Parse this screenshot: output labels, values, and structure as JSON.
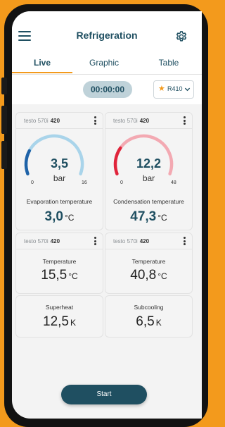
{
  "header": {
    "title": "Refrigeration"
  },
  "tabs": [
    {
      "label": "Live"
    },
    {
      "label": "Graphic"
    },
    {
      "label": "Table"
    }
  ],
  "timer": "00:00:00",
  "refrigerant": "R410",
  "cards": {
    "evap": {
      "device": "testo 570i",
      "device_id": "420",
      "value": "3,5",
      "unit": "bar",
      "min": "0",
      "max": "16",
      "level": 0.22,
      "accent": "#1f63a8",
      "track": "#a9d4ea",
      "label": "Evaporation temperature",
      "temp": "3,0",
      "temp_unit": "°C"
    },
    "cond": {
      "device": "testo 570i",
      "device_id": "420",
      "value": "12,2",
      "unit": "bar",
      "min": "0",
      "max": "48",
      "level": 0.25,
      "accent": "#e0243b",
      "track": "#f3a9b2",
      "label": "Condensation temperature",
      "temp": "47,3",
      "temp_unit": "°C"
    },
    "t1": {
      "device": "testo 570i",
      "device_id": "420",
      "label": "Temperature",
      "value": "15,5",
      "unit": "°C"
    },
    "t2": {
      "device": "testo 570i",
      "device_id": "420",
      "label": "Temperature",
      "value": "40,8",
      "unit": "°C"
    },
    "superheat": {
      "label": "Superheat",
      "value": "12,5",
      "unit": "K"
    },
    "subcooling": {
      "label": "Subcooling",
      "value": "6,5",
      "unit": "K"
    }
  },
  "start_label": "Start"
}
